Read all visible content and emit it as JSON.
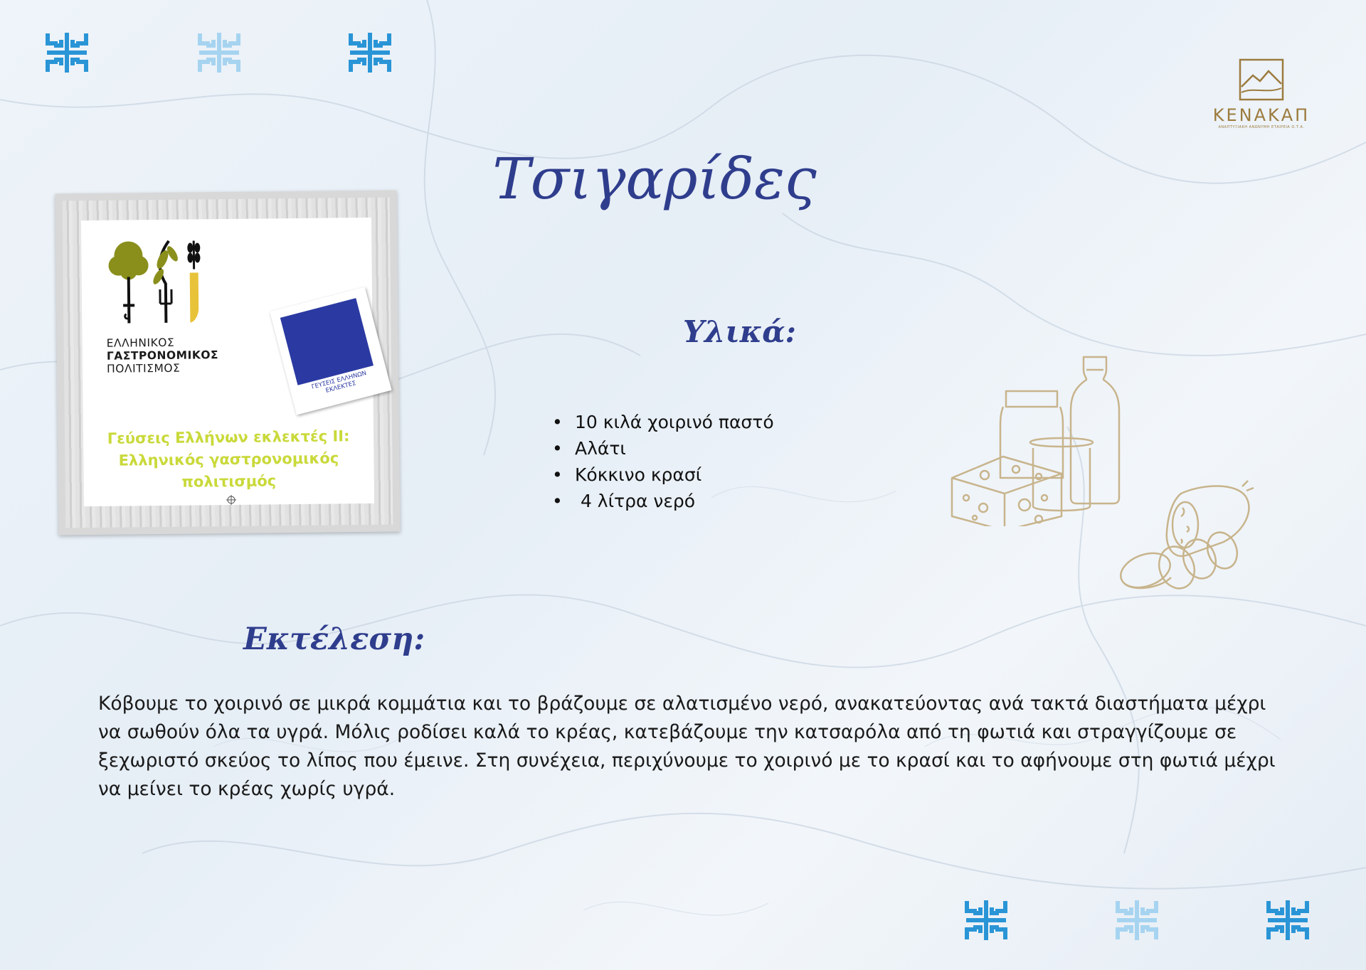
{
  "recipe": {
    "title": "Τσιγαρίδες",
    "ingredients_heading": "Υλικά:",
    "ingredients": [
      "10 κιλά χοιρινό παστό",
      "Αλάτι",
      "Κόκκινο κρασί",
      " 4 λίτρα νερό"
    ],
    "method_heading": "Εκτέλεση:",
    "method_text": "Κόβουμε το χοιρινό σε μικρά κομμάτια και το βράζουμε σε αλατισμένο νερό, ανακατεύοντας ανά τακτά διαστήματα μέχρι να σωθούν όλα τα υγρά. Μόλις ροδίσει καλά το κρέας, κατεβάζουμε την κατσαρόλα από τη φωτιά και στραγγίζουμε σε ξεχωριστό σκεύος το λίπος που έμεινε. Στη συνέχεια, περιχύνουμε το χοιρινό με το κρασί και το αφήνουμε στη φωτιά μέχρι να μείνει το κρέας χωρίς υγρά."
  },
  "publisher_logo": {
    "brand": "ΚΕΝΑΚΑΠ",
    "subtitle": "ΑΝΑΠΤΥΞΙΑΚΗ ΑΝΩΝΥΜΗ ΕΤΑΙΡΕΙΑ Ο.Τ.Α.",
    "emblem_icon": "mountain-emblem-icon",
    "color": "#9c7b3e"
  },
  "badge": {
    "org_line1": "ΕΛΛΗΝΙΚΟΣ",
    "org_line2": "ΓΑΣΤΡΟΝΟΜΙΚΟΣ",
    "org_line3": "ΠΟΛΙΤΙΣΜΟΣ",
    "card_caption_line1": "ΓΕΥΣΕΙΣ ΕΛΛΗΝΩΝ",
    "card_caption_line2": "ΕΚΛΕΚΤΕΣ",
    "series_line1": "Γεύσεις Ελλήνων εκλεκτές ΙΙ:",
    "series_line2": "Ελληνικός γαστρονομικός",
    "series_line3": "πολιτισμός",
    "series_color": "#c9d93a",
    "card_color": "#2b3aa2"
  },
  "decorations": {
    "meander_icon": "greek-meander-icon",
    "meander_color_dark": "#2a95d6",
    "meander_color_light": "#a6d4f0",
    "dairy_icon": "dairy-products-icon",
    "salami_icon": "salami-icon",
    "line_art_color": "#c8b48c"
  },
  "colors": {
    "heading": "#2f3d8d",
    "body_text": "#1a1a1a"
  }
}
